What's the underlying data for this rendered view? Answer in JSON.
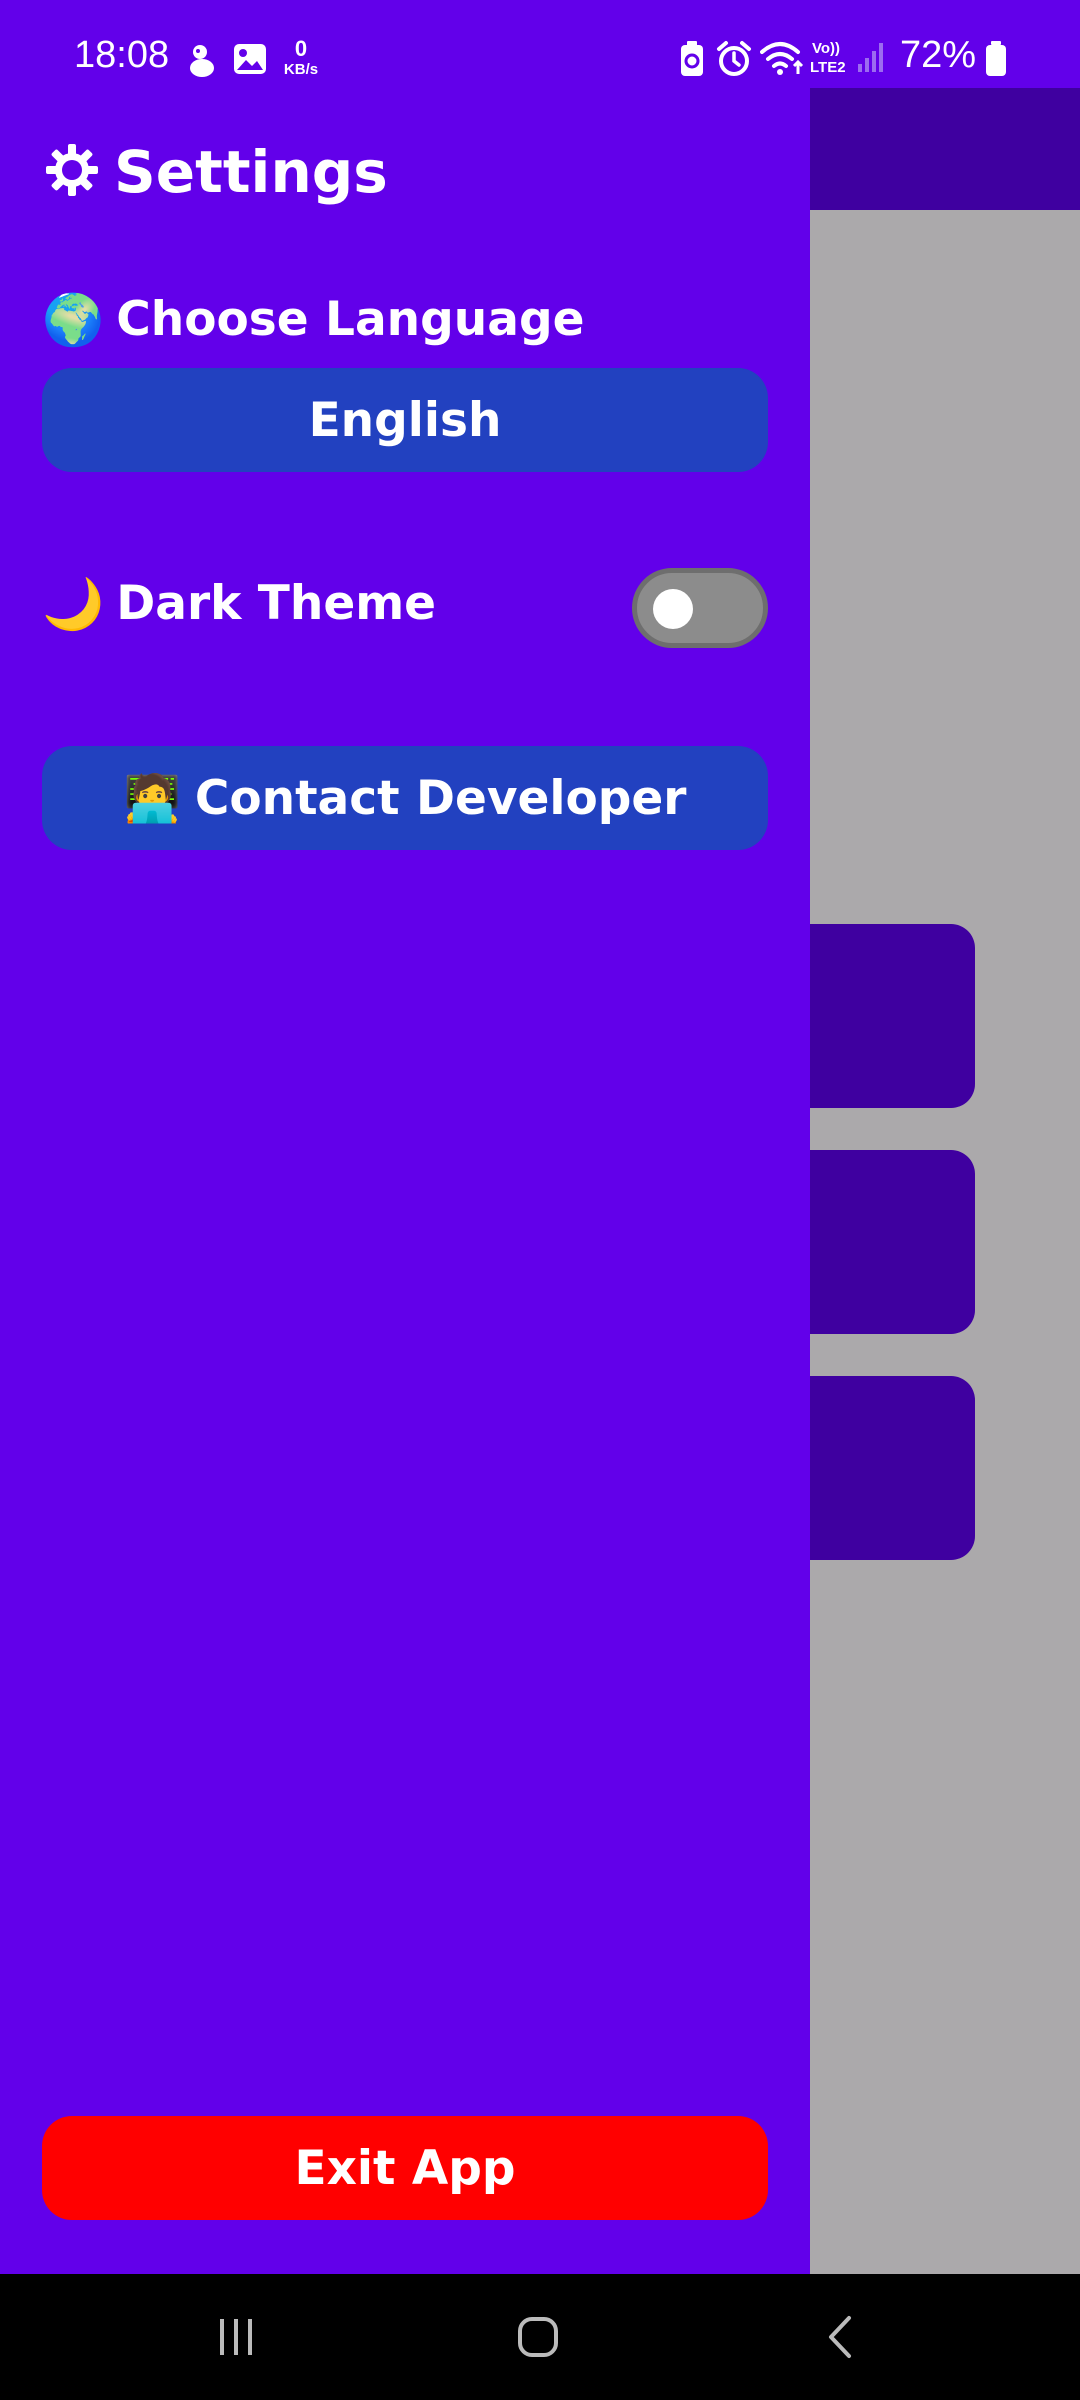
{
  "status_bar": {
    "time": "18:08",
    "net_speed_value": "0",
    "net_speed_unit": "KB/s",
    "battery_percent": "72%",
    "icons": [
      "mascot-icon",
      "gallery-icon",
      "battery-saver-icon",
      "alarm-icon",
      "wifi-icon",
      "volte-lte2-icon",
      "signal-icon",
      "battery-icon"
    ]
  },
  "drawer": {
    "title": "Settings",
    "title_icon": "gear-icon",
    "language": {
      "label": "Choose Language",
      "icon": "🌍",
      "selected": "English"
    },
    "theme": {
      "label": "Dark Theme",
      "icon": "🌙",
      "enabled": false
    },
    "contact": {
      "label": "Contact Developer",
      "icon": "🧑‍💻"
    },
    "exit": {
      "label": "Exit App"
    }
  },
  "colors": {
    "drawer_bg": "#6200EA",
    "button_bg": "#2241C0",
    "exit_bg": "#FF0000",
    "app_toolbar": "#3F00A0",
    "app_bg": "#ABA9AB"
  },
  "nav_bar": {
    "buttons": [
      "recents-icon",
      "home-icon",
      "back-icon"
    ]
  }
}
